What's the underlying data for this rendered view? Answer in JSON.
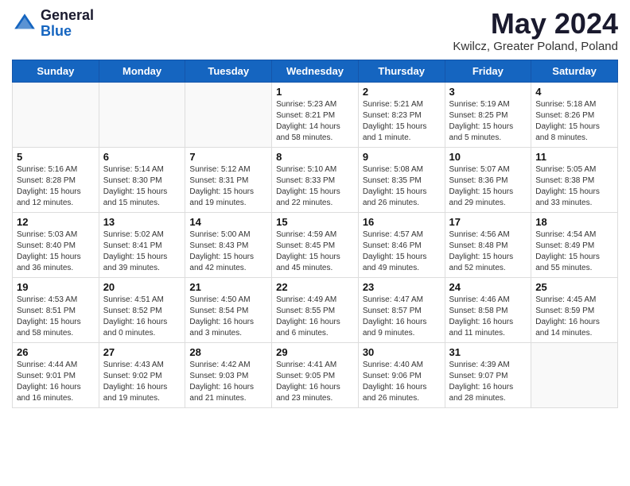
{
  "header": {
    "logo_general": "General",
    "logo_blue": "Blue",
    "month_year": "May 2024",
    "location": "Kwilcz, Greater Poland, Poland"
  },
  "weekdays": [
    "Sunday",
    "Monday",
    "Tuesday",
    "Wednesday",
    "Thursday",
    "Friday",
    "Saturday"
  ],
  "weeks": [
    [
      {
        "day": "",
        "sunrise": "",
        "sunset": "",
        "daylight": ""
      },
      {
        "day": "",
        "sunrise": "",
        "sunset": "",
        "daylight": ""
      },
      {
        "day": "",
        "sunrise": "",
        "sunset": "",
        "daylight": ""
      },
      {
        "day": "1",
        "sunrise": "Sunrise: 5:23 AM",
        "sunset": "Sunset: 8:21 PM",
        "daylight": "Daylight: 14 hours and 58 minutes."
      },
      {
        "day": "2",
        "sunrise": "Sunrise: 5:21 AM",
        "sunset": "Sunset: 8:23 PM",
        "daylight": "Daylight: 15 hours and 1 minute."
      },
      {
        "day": "3",
        "sunrise": "Sunrise: 5:19 AM",
        "sunset": "Sunset: 8:25 PM",
        "daylight": "Daylight: 15 hours and 5 minutes."
      },
      {
        "day": "4",
        "sunrise": "Sunrise: 5:18 AM",
        "sunset": "Sunset: 8:26 PM",
        "daylight": "Daylight: 15 hours and 8 minutes."
      }
    ],
    [
      {
        "day": "5",
        "sunrise": "Sunrise: 5:16 AM",
        "sunset": "Sunset: 8:28 PM",
        "daylight": "Daylight: 15 hours and 12 minutes."
      },
      {
        "day": "6",
        "sunrise": "Sunrise: 5:14 AM",
        "sunset": "Sunset: 8:30 PM",
        "daylight": "Daylight: 15 hours and 15 minutes."
      },
      {
        "day": "7",
        "sunrise": "Sunrise: 5:12 AM",
        "sunset": "Sunset: 8:31 PM",
        "daylight": "Daylight: 15 hours and 19 minutes."
      },
      {
        "day": "8",
        "sunrise": "Sunrise: 5:10 AM",
        "sunset": "Sunset: 8:33 PM",
        "daylight": "Daylight: 15 hours and 22 minutes."
      },
      {
        "day": "9",
        "sunrise": "Sunrise: 5:08 AM",
        "sunset": "Sunset: 8:35 PM",
        "daylight": "Daylight: 15 hours and 26 minutes."
      },
      {
        "day": "10",
        "sunrise": "Sunrise: 5:07 AM",
        "sunset": "Sunset: 8:36 PM",
        "daylight": "Daylight: 15 hours and 29 minutes."
      },
      {
        "day": "11",
        "sunrise": "Sunrise: 5:05 AM",
        "sunset": "Sunset: 8:38 PM",
        "daylight": "Daylight: 15 hours and 33 minutes."
      }
    ],
    [
      {
        "day": "12",
        "sunrise": "Sunrise: 5:03 AM",
        "sunset": "Sunset: 8:40 PM",
        "daylight": "Daylight: 15 hours and 36 minutes."
      },
      {
        "day": "13",
        "sunrise": "Sunrise: 5:02 AM",
        "sunset": "Sunset: 8:41 PM",
        "daylight": "Daylight: 15 hours and 39 minutes."
      },
      {
        "day": "14",
        "sunrise": "Sunrise: 5:00 AM",
        "sunset": "Sunset: 8:43 PM",
        "daylight": "Daylight: 15 hours and 42 minutes."
      },
      {
        "day": "15",
        "sunrise": "Sunrise: 4:59 AM",
        "sunset": "Sunset: 8:45 PM",
        "daylight": "Daylight: 15 hours and 45 minutes."
      },
      {
        "day": "16",
        "sunrise": "Sunrise: 4:57 AM",
        "sunset": "Sunset: 8:46 PM",
        "daylight": "Daylight: 15 hours and 49 minutes."
      },
      {
        "day": "17",
        "sunrise": "Sunrise: 4:56 AM",
        "sunset": "Sunset: 8:48 PM",
        "daylight": "Daylight: 15 hours and 52 minutes."
      },
      {
        "day": "18",
        "sunrise": "Sunrise: 4:54 AM",
        "sunset": "Sunset: 8:49 PM",
        "daylight": "Daylight: 15 hours and 55 minutes."
      }
    ],
    [
      {
        "day": "19",
        "sunrise": "Sunrise: 4:53 AM",
        "sunset": "Sunset: 8:51 PM",
        "daylight": "Daylight: 15 hours and 58 minutes."
      },
      {
        "day": "20",
        "sunrise": "Sunrise: 4:51 AM",
        "sunset": "Sunset: 8:52 PM",
        "daylight": "Daylight: 16 hours and 0 minutes."
      },
      {
        "day": "21",
        "sunrise": "Sunrise: 4:50 AM",
        "sunset": "Sunset: 8:54 PM",
        "daylight": "Daylight: 16 hours and 3 minutes."
      },
      {
        "day": "22",
        "sunrise": "Sunrise: 4:49 AM",
        "sunset": "Sunset: 8:55 PM",
        "daylight": "Daylight: 16 hours and 6 minutes."
      },
      {
        "day": "23",
        "sunrise": "Sunrise: 4:47 AM",
        "sunset": "Sunset: 8:57 PM",
        "daylight": "Daylight: 16 hours and 9 minutes."
      },
      {
        "day": "24",
        "sunrise": "Sunrise: 4:46 AM",
        "sunset": "Sunset: 8:58 PM",
        "daylight": "Daylight: 16 hours and 11 minutes."
      },
      {
        "day": "25",
        "sunrise": "Sunrise: 4:45 AM",
        "sunset": "Sunset: 8:59 PM",
        "daylight": "Daylight: 16 hours and 14 minutes."
      }
    ],
    [
      {
        "day": "26",
        "sunrise": "Sunrise: 4:44 AM",
        "sunset": "Sunset: 9:01 PM",
        "daylight": "Daylight: 16 hours and 16 minutes."
      },
      {
        "day": "27",
        "sunrise": "Sunrise: 4:43 AM",
        "sunset": "Sunset: 9:02 PM",
        "daylight": "Daylight: 16 hours and 19 minutes."
      },
      {
        "day": "28",
        "sunrise": "Sunrise: 4:42 AM",
        "sunset": "Sunset: 9:03 PM",
        "daylight": "Daylight: 16 hours and 21 minutes."
      },
      {
        "day": "29",
        "sunrise": "Sunrise: 4:41 AM",
        "sunset": "Sunset: 9:05 PM",
        "daylight": "Daylight: 16 hours and 23 minutes."
      },
      {
        "day": "30",
        "sunrise": "Sunrise: 4:40 AM",
        "sunset": "Sunset: 9:06 PM",
        "daylight": "Daylight: 16 hours and 26 minutes."
      },
      {
        "day": "31",
        "sunrise": "Sunrise: 4:39 AM",
        "sunset": "Sunset: 9:07 PM",
        "daylight": "Daylight: 16 hours and 28 minutes."
      },
      {
        "day": "",
        "sunrise": "",
        "sunset": "",
        "daylight": ""
      }
    ]
  ]
}
